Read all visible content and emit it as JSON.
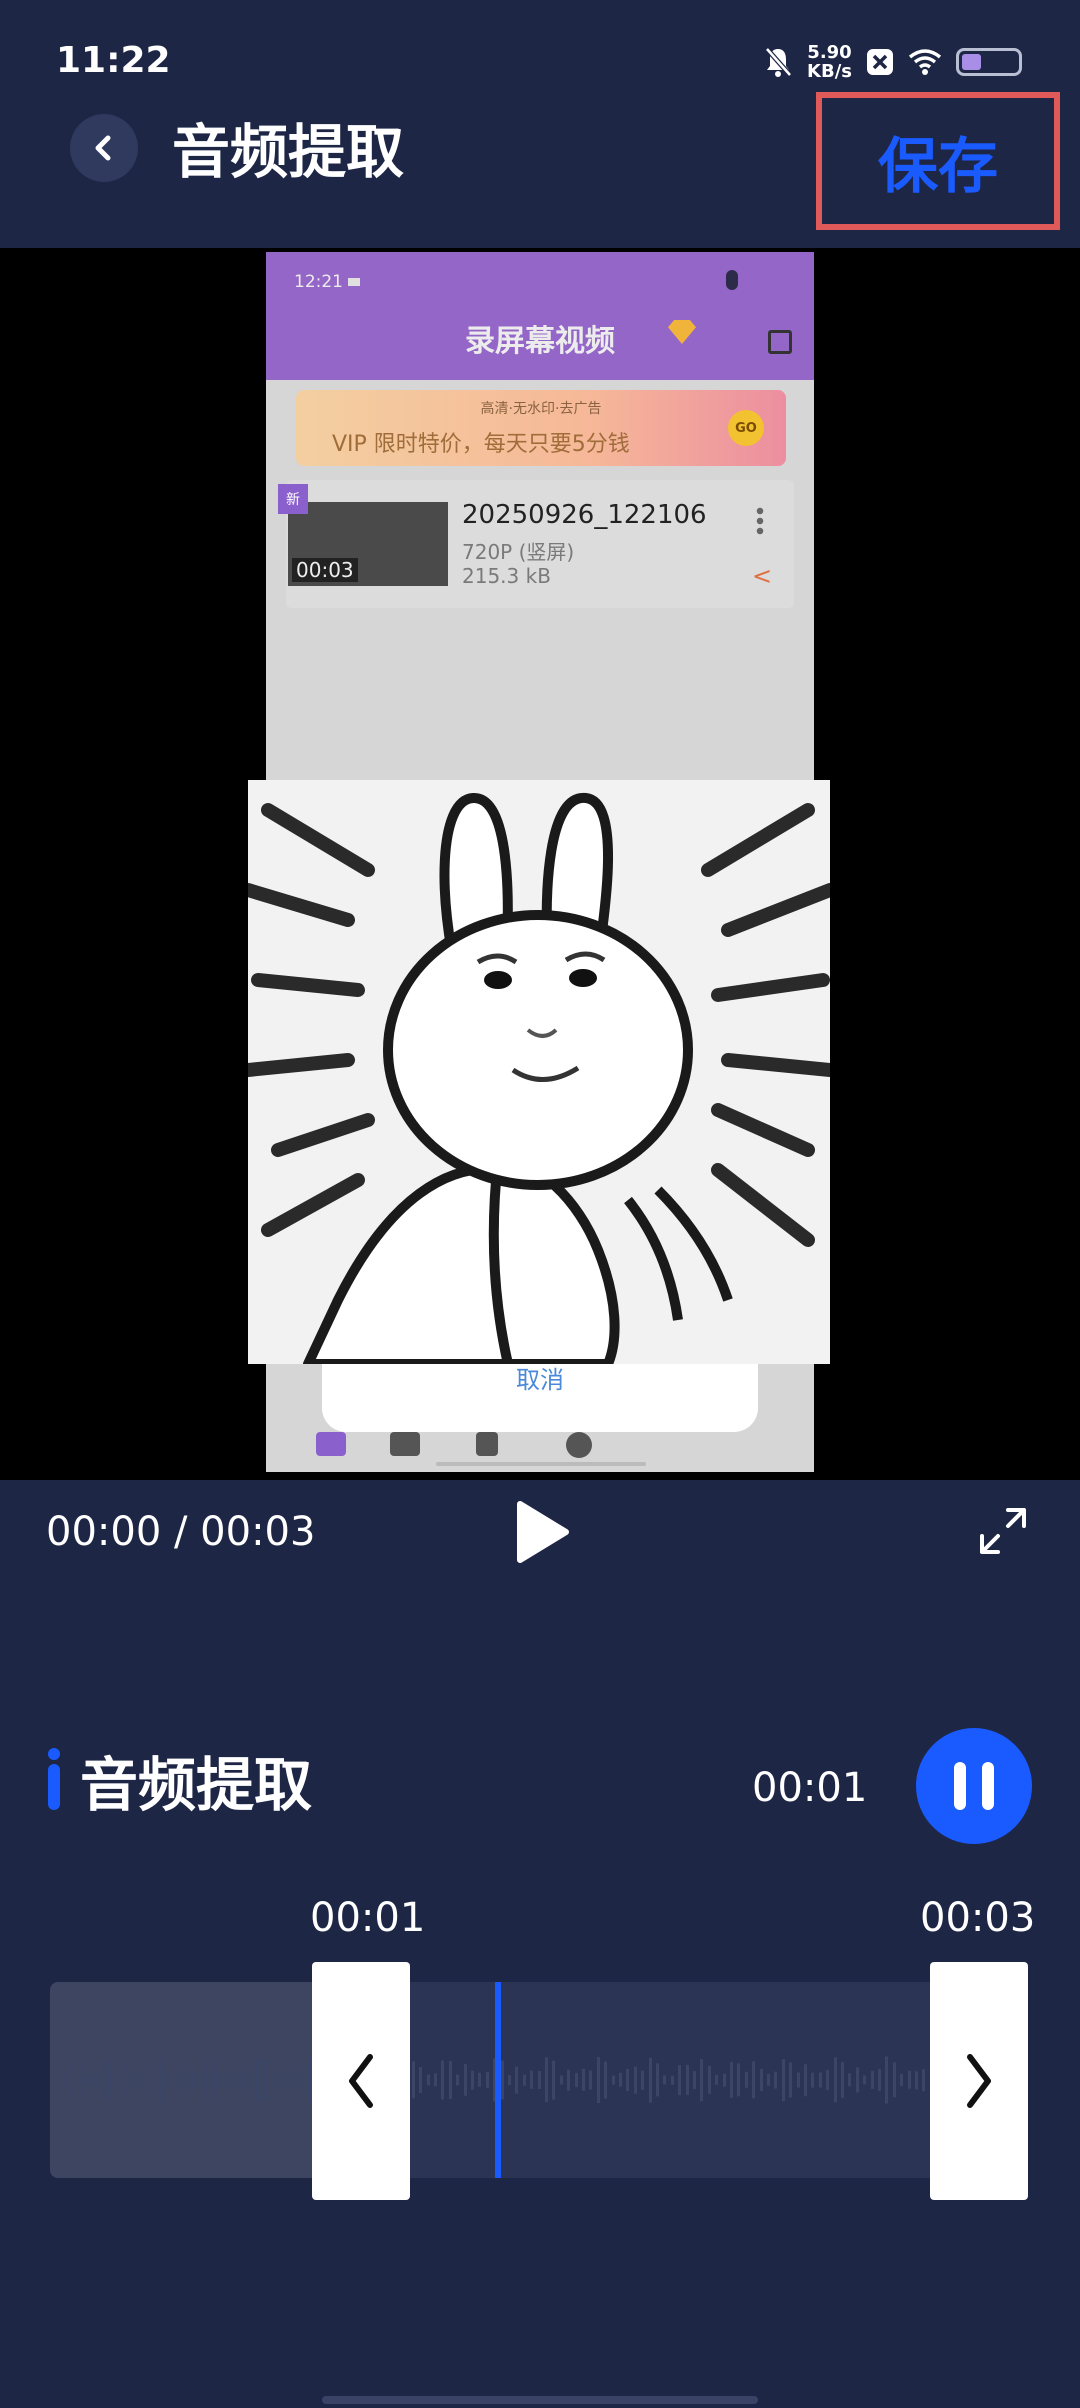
{
  "status_bar": {
    "time": "11:22",
    "net_speed_value": "5.90",
    "net_speed_unit": "KB/s",
    "battery_level": 0.35
  },
  "header": {
    "title": "音频提取",
    "save_label": "保存"
  },
  "preview": {
    "phone": {
      "time": "12:21",
      "title": "录屏幕视频",
      "banner_sub": "高清·无水印·去广告",
      "banner_main": "VIP 限时特价，每天只要5分钱",
      "banner_go": "GO",
      "new_badge": "新",
      "video_name": "20250926_122106",
      "video_duration": "00:03",
      "video_resolution": "720P (竖屏)",
      "video_size": "215.3 kB",
      "dialog_cancel": "取消"
    }
  },
  "player": {
    "timecode": "00:00 / 00:03"
  },
  "audio": {
    "section_title": "音频提取",
    "current_time": "00:01",
    "selection_start": "00:01",
    "selection_end": "00:03"
  },
  "colors": {
    "background": "#1e2646",
    "accent": "#1a5bff",
    "highlight_border": "#e05a5a"
  },
  "icons": {
    "back": "chevron-left-icon",
    "play": "play-icon",
    "fullscreen": "expand-icon",
    "pause": "pause-icon"
  }
}
